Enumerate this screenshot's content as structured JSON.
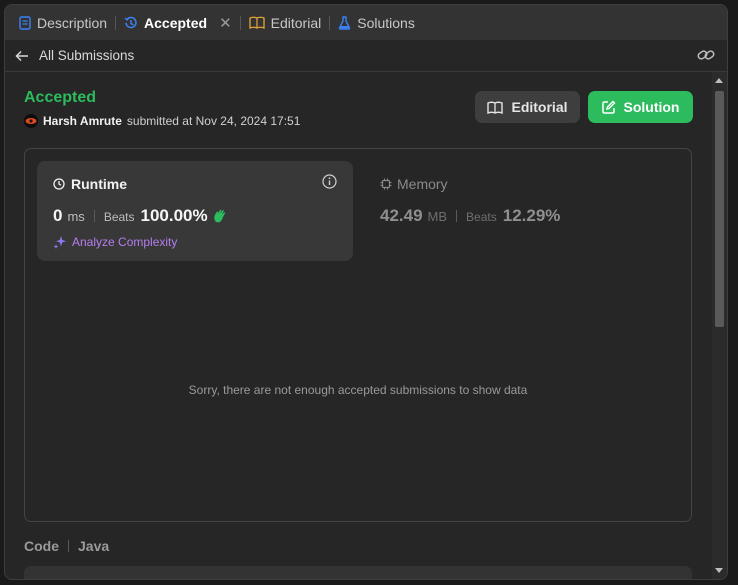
{
  "tabs": [
    {
      "label": "Description",
      "icon": "document-icon"
    },
    {
      "label": "Accepted",
      "icon": "history-icon",
      "active": true
    },
    {
      "label": "Editorial",
      "icon": "book-icon"
    },
    {
      "label": "Solutions",
      "icon": "flask-icon"
    }
  ],
  "subheader": {
    "back_label": "All Submissions"
  },
  "submission": {
    "status": "Accepted",
    "author": "Harsh Amrute",
    "submitted_text": "submitted at Nov 24, 2024 17:51"
  },
  "buttons": {
    "editorial": "Editorial",
    "solution": "Solution"
  },
  "runtime": {
    "title": "Runtime",
    "value": "0",
    "unit": "ms",
    "beats_label": "Beats",
    "beats_value": "100.00%",
    "analyze_label": "Analyze Complexity"
  },
  "memory": {
    "title": "Memory",
    "value": "42.49",
    "unit": "MB",
    "beats_label": "Beats",
    "beats_value": "12.29%"
  },
  "empty_message": "Sorry, there are not enough accepted submissions to show data",
  "code": {
    "label": "Code",
    "language": "Java"
  },
  "colors": {
    "accent_green": "#2cbb5d",
    "analyze_purple": "#b57ef0",
    "panel_bg": "#262626"
  }
}
